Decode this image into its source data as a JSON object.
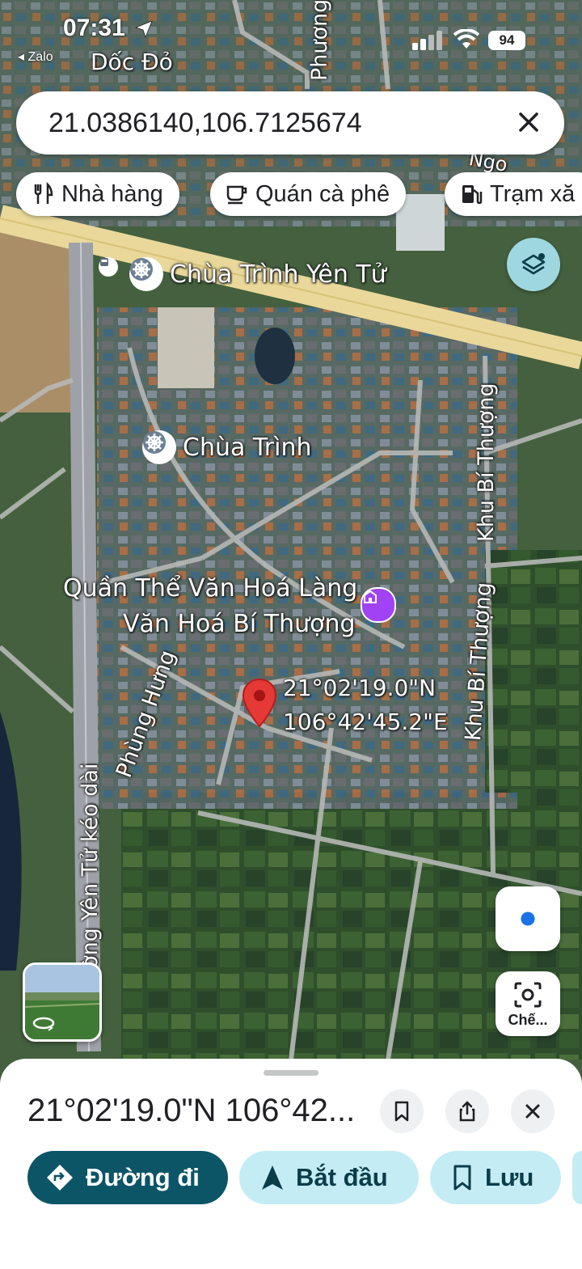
{
  "status_bar": {
    "time": "07:31",
    "back_app": "Zalo",
    "battery": "94"
  },
  "search": {
    "query": "21.0386140,106.7125674"
  },
  "chips": [
    {
      "label": "Nhà hàng",
      "icon": "fork-knife-icon"
    },
    {
      "label": "Quán cà phê",
      "icon": "coffee-cup-icon"
    },
    {
      "label": "Trạm xă",
      "icon": "gas-station-icon"
    }
  ],
  "map": {
    "labels": {
      "doc_do": "Dốc Đỏ",
      "phuong": "Phương",
      "chua_trinh_yen_tu": "Chùa Trình Yên Tử",
      "chua_trinh": "Chùa Trình",
      "quan_the_line1": "Quần Thể Văn Hoá Làng",
      "quan_the_line2": "Văn Hoá Bí Thượng",
      "khu_bi_thuong_1": "Khu Bí Thượng",
      "khu_bi_thuong_2": "Khu Bí Thượng",
      "phung_hung": "Phùng Hưng",
      "yen_tu_road": "ường Yên Tử kéo dài",
      "pin_lat": "21°02'19.0\"N",
      "pin_lng": "106°42'45.2\"E",
      "nga": "Ngo"
    }
  },
  "controls": {
    "lens_label": "Chế..."
  },
  "bottom_sheet": {
    "title": "21°02'19.0\"N 106°42...",
    "actions": [
      {
        "label": "Đường đi",
        "icon": "directions-icon"
      },
      {
        "label": "Bắt đầu",
        "icon": "navigation-arrow-icon"
      },
      {
        "label": "Lưu",
        "icon": "bookmark-icon"
      }
    ]
  },
  "colors": {
    "accent_dark": "#0b5566",
    "accent_light": "#c4ecf4",
    "pin": "#e53935",
    "layers_bg": "#9fd7e0"
  }
}
